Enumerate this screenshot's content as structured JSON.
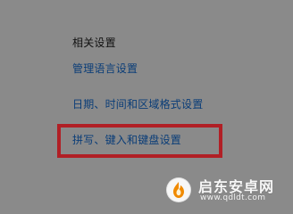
{
  "settings": {
    "section_title": "相关设置",
    "links": [
      "管理语言设置",
      "日期、时间和区域格式设置",
      "拼写、键入和键盘设置"
    ]
  },
  "annotation": {
    "highlight_color": "#b11f25"
  },
  "watermark": {
    "title": "启东安卓网",
    "url": "www.qdldt.com",
    "icon": "flame-logo-icon"
  },
  "colors": {
    "background": "#8a8a8a",
    "link": "#0a3d78",
    "title": "#111111"
  }
}
